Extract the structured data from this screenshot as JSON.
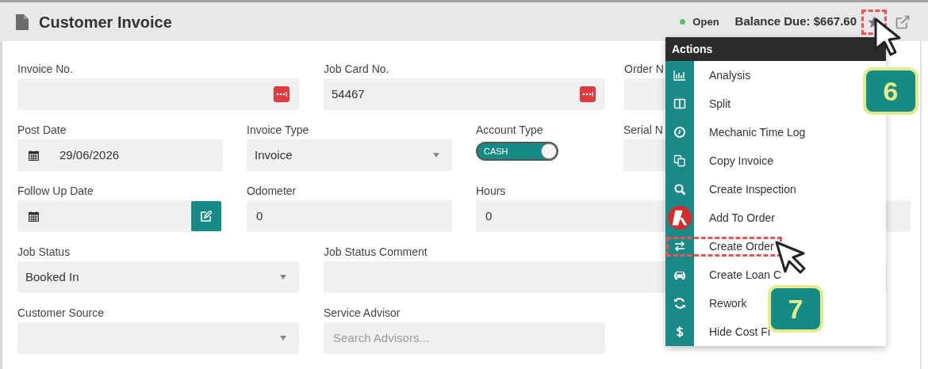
{
  "header": {
    "title": "Customer Invoice",
    "status": {
      "label": "Open",
      "color": "#5cc160"
    },
    "balance": "Balance Due: $667.60",
    "star_highlighted": true
  },
  "form_rows": [
    [
      {
        "label": "Invoice No.",
        "kind": "lookup"
      },
      {
        "label": "Job Card No.",
        "kind": "lookup",
        "value": "54467"
      },
      {
        "label": "Order N",
        "kind": "input"
      }
    ],
    [
      {
        "label": "Post Date",
        "kind": "date",
        "value": "29/06/2026"
      },
      {
        "label": "Invoice Type",
        "kind": "select",
        "value": "Invoice"
      },
      {
        "label": "Account Type",
        "kind": "toggle",
        "value": "CASH",
        "on": true
      },
      {
        "label": "Serial N",
        "kind": "input"
      }
    ],
    [
      {
        "label": "Follow Up Date",
        "kind": "date_edit"
      },
      {
        "label": "Odometer",
        "kind": "input",
        "value": "0"
      },
      {
        "label": "Hours",
        "kind": "input",
        "value": "0"
      }
    ],
    [
      {
        "label": "Job Status",
        "kind": "select",
        "value": "Booked In"
      },
      {
        "label": "Job Status Comment",
        "kind": "input"
      }
    ],
    [
      {
        "label": "Customer Source",
        "kind": "select"
      },
      {
        "label": "Service Advisor",
        "kind": "input",
        "placeholder": "Search Advisors..."
      }
    ]
  ],
  "actions_menu": {
    "title": "Actions",
    "items": [
      {
        "label": "Analysis",
        "highlighted": false
      },
      {
        "label": "Split",
        "highlighted": false
      },
      {
        "label": "Mechanic Time Log",
        "highlighted": false
      },
      {
        "label": "Copy Invoice",
        "highlighted": false
      },
      {
        "label": "Create Inspection",
        "highlighted": false
      },
      {
        "label": "Add To Order",
        "highlighted": false
      },
      {
        "label": "Create Order",
        "highlighted": true
      },
      {
        "label": "Create Loan C",
        "highlighted": false
      },
      {
        "label": "Rework",
        "highlighted": false
      },
      {
        "label": "Hide Cost Fi",
        "highlighted": false
      }
    ]
  },
  "step_badges": [
    {
      "label": "6"
    },
    {
      "label": "7"
    }
  ]
}
